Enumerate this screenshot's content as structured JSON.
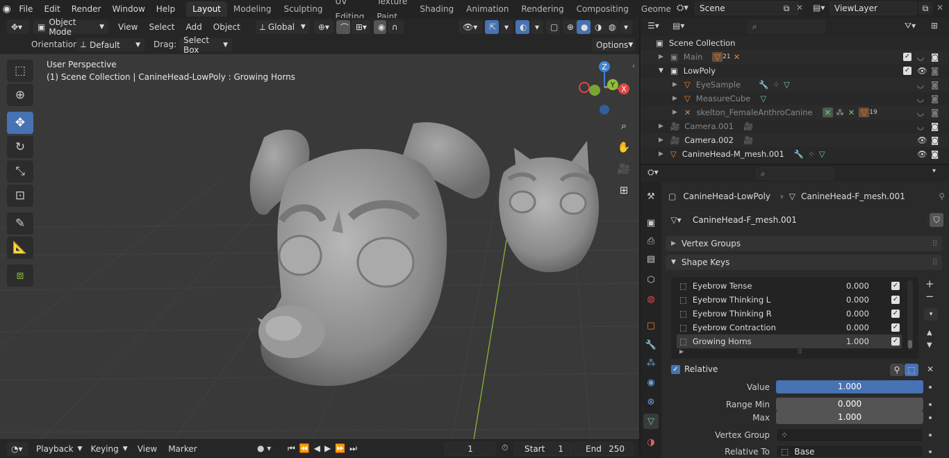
{
  "topbar": {
    "menus": [
      "File",
      "Edit",
      "Render",
      "Window",
      "Help"
    ],
    "workspaces": [
      "Layout",
      "Modeling",
      "Sculpting",
      "UV Editing",
      "Texture Paint",
      "Shading",
      "Animation",
      "Rendering",
      "Compositing",
      "Geometry Noc"
    ],
    "active_workspace": "Layout",
    "scene": "Scene",
    "view_layer": "ViewLayer"
  },
  "viewport_header": {
    "mode": "Object Mode",
    "menus": [
      "View",
      "Select",
      "Add",
      "Object"
    ],
    "transform_orientation": "Global",
    "orientation_label": "Orientation:",
    "orientation_value": "Default",
    "drag_label": "Drag:",
    "drag_value": "Select Box",
    "options_label": "Options"
  },
  "viewport": {
    "perspective": "User Perspective",
    "context": "(1) Scene Collection | CanineHead-LowPoly : Growing Horns",
    "gizmo": {
      "z": "Z",
      "y": "Y",
      "x": "X"
    }
  },
  "timeline": {
    "menus": [
      "Playback",
      "Keying",
      "View",
      "Marker"
    ],
    "current_frame": "1",
    "start_label": "Start",
    "start_value": "1",
    "end_label": "End",
    "end_value": "250"
  },
  "outliner": {
    "search_placeholder": "",
    "root": "Scene Collection",
    "rows": [
      {
        "name": "Main",
        "badge": "21"
      },
      {
        "name": "LowPoly"
      },
      {
        "name": "EyeSample"
      },
      {
        "name": "MeasureCube"
      },
      {
        "name": "skelton_FemaleAnthroCanine",
        "badge": "19"
      },
      {
        "name": "Camera.001"
      },
      {
        "name": "Camera.002"
      },
      {
        "name": "CanineHead-M_mesh.001"
      }
    ]
  },
  "properties": {
    "breadcrumb_object": "CanineHead-LowPoly",
    "breadcrumb_data": "CanineHead-F_mesh.001",
    "mesh_name": "CanineHead-F_mesh.001",
    "vertex_groups_label": "Vertex Groups",
    "shape_keys_label": "Shape Keys",
    "shape_keys": [
      {
        "name": "Eyebrow Tense",
        "value": "0.000"
      },
      {
        "name": "Eyebrow Thinking L",
        "value": "0.000"
      },
      {
        "name": "Eyebrow Thinking R",
        "value": "0.000"
      },
      {
        "name": "Eyebrow Contraction",
        "value": "0.000"
      },
      {
        "name": "Growing Horns",
        "value": "1.000"
      }
    ],
    "relative_label": "Relative",
    "value_label": "Value",
    "value": "1.000",
    "value_fraction": 1.0,
    "range_min_label": "Range Min",
    "range_min": "0.000",
    "max_label": "Max",
    "max": "1.000",
    "vertex_group_label": "Vertex Group",
    "vertex_group_value": "",
    "relative_to_label": "Relative To",
    "relative_to_value": "Base"
  },
  "colors": {
    "accent": "#4772b3",
    "axis_x": "#e04545",
    "axis_y": "#8fbf38",
    "axis_z": "#3d82d6",
    "object_orange": "#e8873a",
    "data_green": "#5fd38d"
  }
}
